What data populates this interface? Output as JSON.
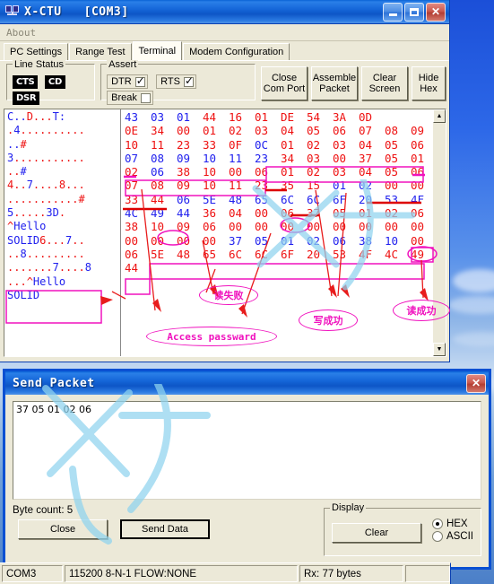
{
  "window": {
    "title": "X-CTU   [COM3]",
    "icon": "modem-icon",
    "minimize": "minimize-icon",
    "maximize": "maximize-icon",
    "close": "close-icon"
  },
  "menu": {
    "items": [
      "About"
    ]
  },
  "tabs": [
    {
      "label": "PC Settings",
      "active": false
    },
    {
      "label": "Range Test",
      "active": false
    },
    {
      "label": "Terminal",
      "active": true
    },
    {
      "label": "Modem Configuration",
      "active": false
    }
  ],
  "line_status": {
    "label": "Line Status",
    "leds": [
      "CTS",
      "CD",
      "DSR"
    ]
  },
  "assert": {
    "label": "Assert",
    "items": [
      {
        "label": "DTR",
        "checked": true
      },
      {
        "label": "RTS",
        "checked": true
      },
      {
        "label": "Break",
        "checked": false
      }
    ]
  },
  "toolbar": {
    "buttons": [
      {
        "line1": "Close",
        "line2": "Com Port"
      },
      {
        "line1": "Assemble",
        "line2": "Packet"
      },
      {
        "line1": "Clear",
        "line2": "Screen"
      },
      {
        "line1": "Hide",
        "line2": "Hex"
      }
    ]
  },
  "terminal": {
    "ascii_lines": [
      [
        {
          "t": "C..",
          "c": "tx"
        },
        {
          "t": "D...",
          "c": "rx"
        },
        {
          "t": "T:",
          "c": "tx"
        }
      ],
      [
        {
          "t": ".",
          "c": "rx"
        },
        {
          "t": "4",
          "c": "tx"
        },
        {
          "t": "..........",
          "c": "rx"
        }
      ],
      [
        {
          "t": "..",
          "c": "tx"
        },
        {
          "t": "#",
          "c": "rx"
        }
      ],
      [
        {
          "t": "3",
          "c": "tx"
        },
        {
          "t": "...........",
          "c": "rx"
        }
      ],
      [
        {
          "t": "..",
          "c": "rx"
        },
        {
          "t": "#",
          "c": "tx"
        }
      ],
      [
        {
          "t": "4",
          "c": "rx"
        },
        {
          "t": "..",
          "c": "rx"
        },
        {
          "t": "7",
          "c": "tx"
        },
        {
          "t": "....",
          "c": "rx"
        },
        {
          "t": "8",
          "c": "rx"
        },
        {
          "t": "...",
          "c": "rx"
        }
      ],
      [
        {
          "t": "...........",
          "c": "rx"
        },
        {
          "t": "#",
          "c": "rx"
        }
      ],
      [
        {
          "t": "5",
          "c": "tx"
        },
        {
          "t": ".....",
          "c": "rx"
        },
        {
          "t": "3D",
          "c": "tx"
        },
        {
          "t": ".",
          "c": "rx"
        }
      ],
      [
        {
          "t": "^",
          "c": "rx"
        },
        {
          "t": "Hello",
          "c": "tx"
        }
      ],
      [
        {
          "t": "SOLID",
          "c": "tx"
        },
        {
          "t": "6",
          "c": "rx"
        },
        {
          "t": "...",
          "c": "rx"
        },
        {
          "t": "7",
          "c": "tx"
        },
        {
          "t": "..",
          "c": "rx"
        }
      ],
      [
        {
          "t": "..",
          "c": "rx"
        },
        {
          "t": "8",
          "c": "tx"
        },
        {
          "t": ".........",
          "c": "rx"
        }
      ],
      [
        {
          "t": ".......",
          "c": "rx"
        },
        {
          "t": "7",
          "c": "tx"
        },
        {
          "t": "....",
          "c": "rx"
        },
        {
          "t": "8",
          "c": "tx"
        }
      ],
      [
        {
          "t": "...",
          "c": "rx"
        },
        {
          "t": "^",
          "c": "rx"
        },
        {
          "t": "Hello",
          "c": "tx"
        }
      ],
      [
        {
          "t": "SOLID",
          "c": "tx"
        }
      ]
    ],
    "hex_rows": [
      [
        {
          "v": "43",
          "c": "tx"
        },
        {
          "v": "03",
          "c": "tx"
        },
        {
          "v": "01",
          "c": "tx"
        },
        {
          "v": "44",
          "c": "rx"
        },
        {
          "v": "16",
          "c": "rx"
        },
        {
          "v": "01",
          "c": "rx"
        },
        {
          "v": "DE",
          "c": "rx"
        },
        {
          "v": "54",
          "c": "rx"
        },
        {
          "v": "3A",
          "c": "rx"
        },
        {
          "v": "0D",
          "c": "rx"
        }
      ],
      [
        {
          "v": "0E",
          "c": "rx"
        },
        {
          "v": "34",
          "c": "rx"
        },
        {
          "v": "00",
          "c": "rx"
        },
        {
          "v": "01",
          "c": "rx"
        },
        {
          "v": "02",
          "c": "rx"
        },
        {
          "v": "03",
          "c": "rx"
        },
        {
          "v": "04",
          "c": "rx"
        },
        {
          "v": "05",
          "c": "rx"
        },
        {
          "v": "06",
          "c": "rx"
        },
        {
          "v": "07",
          "c": "rx"
        },
        {
          "v": "08",
          "c": "rx"
        },
        {
          "v": "09",
          "c": "rx"
        }
      ],
      [
        {
          "v": "10",
          "c": "rx"
        },
        {
          "v": "11",
          "c": "rx"
        },
        {
          "v": "23",
          "c": "rx"
        },
        {
          "v": "33",
          "c": "rx"
        },
        {
          "v": "0F",
          "c": "rx"
        },
        {
          "v": "0C",
          "c": "tx"
        },
        {
          "v": "01",
          "c": "rx"
        },
        {
          "v": "02",
          "c": "rx"
        },
        {
          "v": "03",
          "c": "rx"
        },
        {
          "v": "04",
          "c": "rx"
        },
        {
          "v": "05",
          "c": "rx"
        },
        {
          "v": "06",
          "c": "rx"
        }
      ],
      [
        {
          "v": "07",
          "c": "tx"
        },
        {
          "v": "08",
          "c": "tx"
        },
        {
          "v": "09",
          "c": "tx"
        },
        {
          "v": "10",
          "c": "tx"
        },
        {
          "v": "11",
          "c": "tx"
        },
        {
          "v": "23",
          "c": "tx"
        },
        {
          "v": "34",
          "c": "rx"
        },
        {
          "v": "03",
          "c": "rx"
        },
        {
          "v": "00",
          "c": "rx"
        },
        {
          "v": "37",
          "c": "rx"
        },
        {
          "v": "05",
          "c": "rx"
        },
        {
          "v": "01",
          "c": "rx"
        }
      ],
      [
        {
          "v": "02",
          "c": "rx"
        },
        {
          "v": "06",
          "c": "tx"
        },
        {
          "v": "38",
          "c": "rx"
        },
        {
          "v": "10",
          "c": "rx"
        },
        {
          "v": "00",
          "c": "rx"
        },
        {
          "v": "06",
          "c": "rx"
        },
        {
          "v": "01",
          "c": "rx"
        },
        {
          "v": "02",
          "c": "rx"
        },
        {
          "v": "03",
          "c": "rx"
        },
        {
          "v": "04",
          "c": "rx"
        },
        {
          "v": "05",
          "c": "rx"
        },
        {
          "v": "06",
          "c": "rx"
        }
      ],
      [
        {
          "v": "07",
          "c": "rx"
        },
        {
          "v": "08",
          "c": "rx"
        },
        {
          "v": "09",
          "c": "rx"
        },
        {
          "v": "10",
          "c": "rx"
        },
        {
          "v": "11",
          "c": "rx"
        },
        {
          "v": "23",
          "c": "rx"
        },
        {
          "v": "35",
          "c": "rx"
        },
        {
          "v": "15",
          "c": "rx"
        },
        {
          "v": "01",
          "c": "tx"
        },
        {
          "v": "02",
          "c": "tx"
        },
        {
          "v": "00",
          "c": "rx"
        },
        {
          "v": "00",
          "c": "rx"
        }
      ],
      [
        {
          "v": "33",
          "c": "rx"
        },
        {
          "v": "44",
          "c": "rx"
        },
        {
          "v": "06",
          "c": "tx"
        },
        {
          "v": "5E",
          "c": "tx"
        },
        {
          "v": "48",
          "c": "tx"
        },
        {
          "v": "65",
          "c": "tx"
        },
        {
          "v": "6C",
          "c": "tx"
        },
        {
          "v": "6C",
          "c": "tx"
        },
        {
          "v": "6F",
          "c": "tx"
        },
        {
          "v": "20",
          "c": "tx"
        },
        {
          "v": "53",
          "c": "tx"
        },
        {
          "v": "4F",
          "c": "tx"
        }
      ],
      [
        {
          "v": "4C",
          "c": "tx"
        },
        {
          "v": "49",
          "c": "tx"
        },
        {
          "v": "44",
          "c": "tx"
        },
        {
          "v": "36",
          "c": "rx"
        },
        {
          "v": "04",
          "c": "rx"
        },
        {
          "v": "00",
          "c": "rx"
        },
        {
          "v": "06",
          "c": "rx"
        },
        {
          "v": "37",
          "c": "rx"
        },
        {
          "v": "05",
          "c": "rx"
        },
        {
          "v": "01",
          "c": "rx"
        },
        {
          "v": "02",
          "c": "rx"
        },
        {
          "v": "06",
          "c": "rx"
        }
      ],
      [
        {
          "v": "38",
          "c": "rx"
        },
        {
          "v": "10",
          "c": "rx"
        },
        {
          "v": "09",
          "c": "rx"
        },
        {
          "v": "06",
          "c": "rx"
        },
        {
          "v": "00",
          "c": "rx"
        },
        {
          "v": "00",
          "c": "rx"
        },
        {
          "v": "00",
          "c": "rx"
        },
        {
          "v": "00",
          "c": "rx"
        },
        {
          "v": "00",
          "c": "rx"
        },
        {
          "v": "00",
          "c": "rx"
        },
        {
          "v": "00",
          "c": "rx"
        },
        {
          "v": "00",
          "c": "rx"
        }
      ],
      [
        {
          "v": "00",
          "c": "rx"
        },
        {
          "v": "00",
          "c": "rx"
        },
        {
          "v": "00",
          "c": "rx"
        },
        {
          "v": "00",
          "c": "rx"
        },
        {
          "v": "37",
          "c": "tx"
        },
        {
          "v": "05",
          "c": "tx"
        },
        {
          "v": "01",
          "c": "tx"
        },
        {
          "v": "02",
          "c": "tx"
        },
        {
          "v": "06",
          "c": "tx"
        },
        {
          "v": "38",
          "c": "tx"
        },
        {
          "v": "10",
          "c": "tx"
        },
        {
          "v": "00",
          "c": "rx"
        }
      ],
      [
        {
          "v": "06",
          "c": "rx"
        },
        {
          "v": "5E",
          "c": "rx"
        },
        {
          "v": "48",
          "c": "rx"
        },
        {
          "v": "65",
          "c": "rx"
        },
        {
          "v": "6C",
          "c": "rx"
        },
        {
          "v": "6C",
          "c": "rx"
        },
        {
          "v": "6F",
          "c": "rx"
        },
        {
          "v": "20",
          "c": "rx"
        },
        {
          "v": "53",
          "c": "rx"
        },
        {
          "v": "4F",
          "c": "rx"
        },
        {
          "v": "4C",
          "c": "rx"
        },
        {
          "v": "49",
          "c": "rx"
        }
      ],
      [
        {
          "v": "44",
          "c": "rx"
        }
      ]
    ]
  },
  "annotations": [
    {
      "text": "读失败",
      "shape": "ellipse"
    },
    {
      "text": "Access passward",
      "shape": "ellipse"
    },
    {
      "text": "写成功",
      "shape": "ellipse"
    },
    {
      "text": "读成功",
      "shape": "ellipse"
    }
  ],
  "send_packet": {
    "title": "Send Packet",
    "close": "close-icon",
    "packet_value": "37 05 01 02 06",
    "byte_count_label": "Byte count: 5",
    "close_button": "Close",
    "send_button": "Send Data",
    "display": {
      "label": "Display",
      "clear_button": "Clear",
      "options": [
        {
          "label": "HEX",
          "selected": true
        },
        {
          "label": "ASCII",
          "selected": false
        }
      ]
    }
  },
  "statusbar": {
    "port": "COM3",
    "settings": "115200 8-N-1  FLOW:NONE",
    "rx": "Rx: 77 bytes",
    "extra": ""
  },
  "colors": {
    "tx": "#2020ee",
    "rx": "#ee1111",
    "annotation": "#f012be",
    "titlebar": "#0a63d6"
  }
}
